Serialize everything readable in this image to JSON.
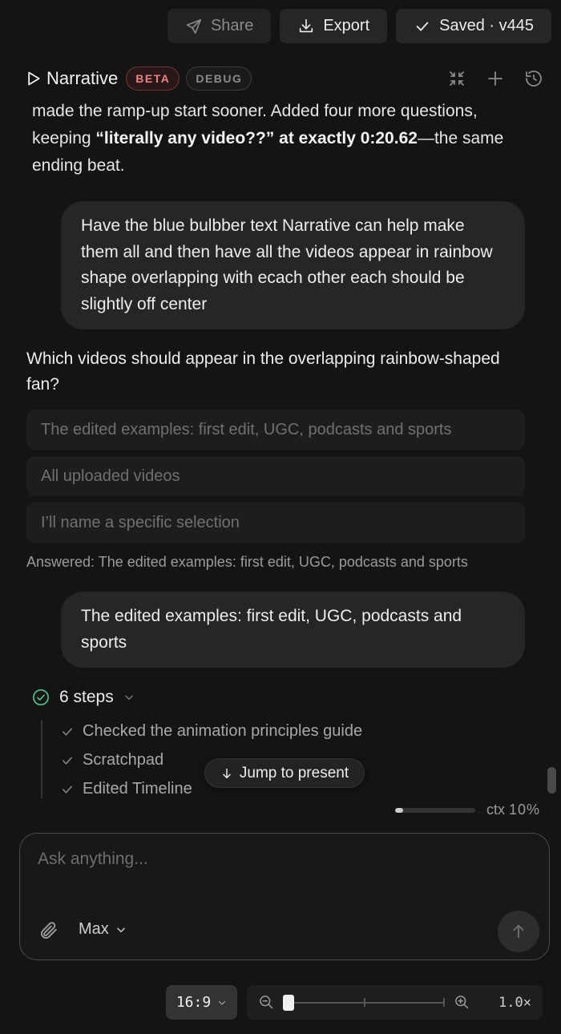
{
  "toolbar": {
    "share_label": "Share",
    "export_label": "Export",
    "saved_label": "Saved · v445"
  },
  "header": {
    "brand": "Narrative",
    "beta_badge": "BETA",
    "debug_badge": "DEBUG"
  },
  "conversation": {
    "assistant_text_1": "made the ramp-up start sooner. Added four more questions, keeping ",
    "assistant_text_bold": "“literally any video??” at exactly 0:20.62",
    "assistant_text_2": "—the same ending beat.",
    "user_message_1": "Have the blue bulbber text Narrative can help make them all and then have all the videos  appear in rainbow shape overlapping with ecach other each should be slightly off center",
    "question": "Which videos should appear in the overlapping rainbow-shaped fan?",
    "options": [
      "The edited examples: first edit, UGC, podcasts and sports",
      "All uploaded videos",
      "I’ll name a specific selection"
    ],
    "answered": "Answered: The edited examples: first edit, UGC, podcasts and sports",
    "user_message_2": "The edited examples: first edit, UGC, podcasts and sports",
    "steps_label": "6 steps",
    "steps": [
      "Checked the animation principles guide",
      "Scratchpad",
      "Edited Timeline"
    ],
    "jump_label": "Jump to present"
  },
  "context": {
    "label": "ctx",
    "percent_text": "10%",
    "fill_fraction": 0.1
  },
  "composer": {
    "placeholder": "Ask anything...",
    "model": "Max"
  },
  "bottom": {
    "aspect_ratio": "16:9",
    "zoom_value": "1.0×"
  },
  "colors": {
    "background": "#141414",
    "bubble": "#262626",
    "success_green": "#4cc38a",
    "beta_red": "#e8837f"
  }
}
